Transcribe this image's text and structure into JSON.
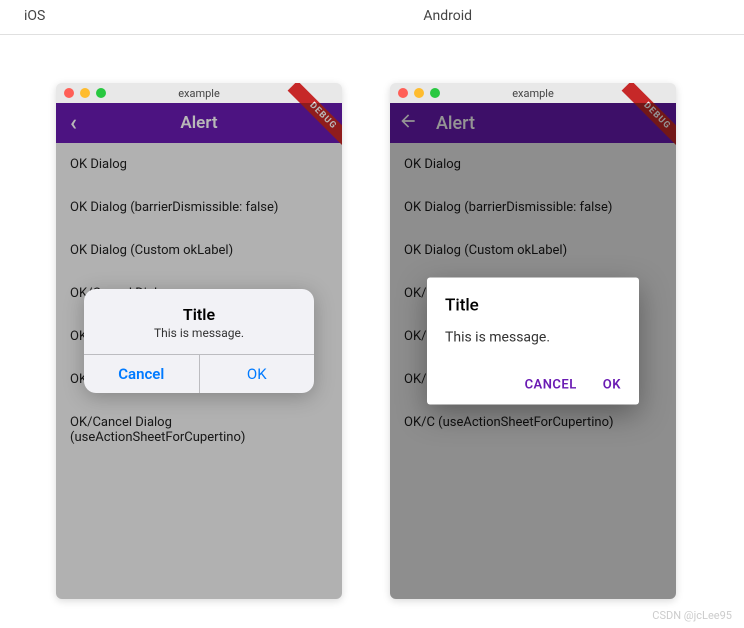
{
  "header": {
    "ios": "iOS",
    "android": "Android"
  },
  "window_title": "example",
  "debug": "DEBUG",
  "app_title": "Alert",
  "list_items": [
    "OK Dialog",
    "OK Dialog (barrierDismissible: false)",
    "OK Dialog (Custom okLabel)",
    "OK/Cancel Dialog",
    "OK/C",
    "OK/C",
    "OK/Cancel Dialog (useActionSheetForCupertino)"
  ],
  "android_list_items": [
    "OK Dialog",
    "OK Dialog (barrierDismissible: false)",
    "OK Dialog (Custom okLabel)",
    "OK/C",
    "OK/C",
    "OK/C",
    "OK/C (useActionSheetForCupertino)"
  ],
  "dialog": {
    "title": "Title",
    "message": "This is message.",
    "cancel": "Cancel",
    "ok": "OK",
    "cancel_upper": "CANCEL",
    "ok_upper": "OK"
  },
  "watermark": "CSDN @jcLee95"
}
